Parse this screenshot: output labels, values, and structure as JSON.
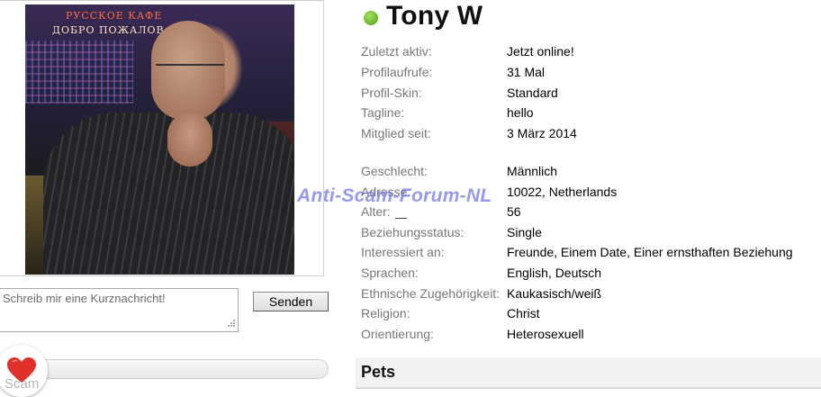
{
  "profile": {
    "name": "Tony W",
    "online_color": "#6dbb2b",
    "photo_sign_line1": "РУССКОЕ КАФЕ",
    "photo_sign_line2": "ДОБРО ПОЖАЛОВ"
  },
  "details": [
    {
      "label": "Zuletzt aktiv:",
      "value": "Jetzt online!"
    },
    {
      "label": "Profilaufrufe:",
      "value": "31 Mal"
    },
    {
      "label": "Profil-Skin:",
      "value": "Standard"
    },
    {
      "label": "Tagline:",
      "value": "hello"
    },
    {
      "label": "Mitglied seit:",
      "value": "3 März 2014"
    },
    {
      "label": "Geschlecht:",
      "value": "Männlich"
    },
    {
      "label": "Adresse:",
      "value": "10022, Netherlands"
    },
    {
      "label": "Alter:",
      "value": "56"
    },
    {
      "label": "Beziehungsstatus:",
      "value": "Single"
    },
    {
      "label": "Interessiert an:",
      "value": "Freunde, Einem Date, Einer ernsthaften Beziehung"
    },
    {
      "label": "Sprachen:",
      "value": "English, Deutsch"
    },
    {
      "label": "Ethnische Zugehörigkeit:",
      "value": "Kaukasisch/weiß"
    },
    {
      "label": "Religion:",
      "value": "Christ"
    },
    {
      "label": "Orientierung:",
      "value": "Heterosexuell"
    }
  ],
  "message": {
    "placeholder": "Schreib mir eine Kurznachricht!",
    "value": "",
    "send_label": "Senden"
  },
  "like": {
    "icon": "heart-icon",
    "color": "#e0302a"
  },
  "sections": {
    "pets_title": "Pets"
  },
  "watermark": {
    "text": "Anti-Scam-Forum-NL",
    "bottom_text": "Scam"
  }
}
